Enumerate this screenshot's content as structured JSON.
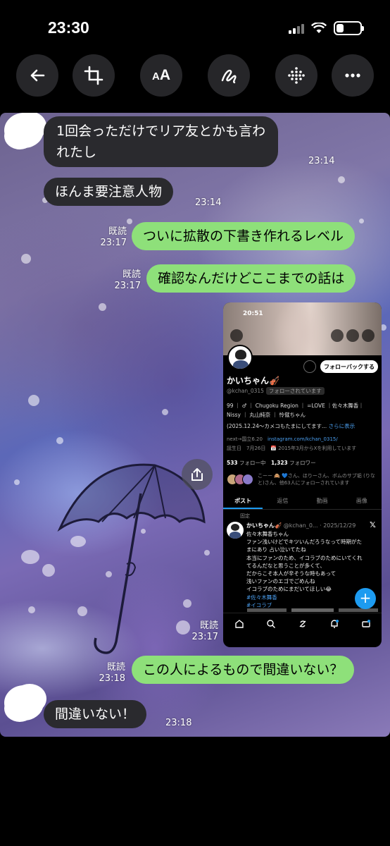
{
  "status_bar": {
    "time": "23:30"
  },
  "toolbar": {
    "text_size_small": "A",
    "text_size_large": "A"
  },
  "chat": {
    "messages": [
      {
        "side": "left",
        "line1": "1回会っただけでリア友とかも言わ",
        "line2": "れたし",
        "time": "23:14"
      },
      {
        "side": "left",
        "text": "ほんま要注意人物",
        "time": "23:14"
      },
      {
        "side": "right",
        "text": "ついに拡散の下書き作れるレベル",
        "read": "既読",
        "time": "23:17"
      },
      {
        "side": "right",
        "text": "確認なんだけどここまでの話は",
        "read": "既読",
        "time": "23:17"
      },
      {
        "side": "right",
        "type": "image",
        "read": "既読",
        "time": "23:17"
      },
      {
        "side": "right",
        "text": "この人によるもので間違いない？",
        "read": "既読",
        "time": "23:18"
      },
      {
        "side": "left",
        "text": "間違いない！",
        "time": "23:18"
      }
    ]
  },
  "twitter": {
    "time": "20:51",
    "follow_back": "フォローバックする",
    "name": "かいちゃん🎻",
    "handle": "@kchan_0315",
    "follows_you": "フォローされています",
    "bio_line1": "99 ｜ ♂ ｜ Chugoku Region ｜ =LOVE ｜佐々木舞香｜",
    "bio_line2": "Nissy ｜ 丸山純奈 ｜ 怜僦ちゃん",
    "bio_line3_prefix": "(2025.12.24〜カメコもたまにしてます...",
    "bio_more": "さらに表示",
    "meta_line1_prefix": "next→国立6.20",
    "meta_link": "instagram.com/kchan_0315/",
    "meta_line2": "誕生日　7月26日　📅 2015年3月からXを利用しています",
    "following_count": "533",
    "following_label": "フォロー中",
    "followers_count": "1,323",
    "followers_label": "フォロワー",
    "mutual_line1": "こーー 🙈 💙さん、ほりーさん、ボムのサブ垢 (りな",
    "mutual_line2": "と)さん、他63人にフォローされています",
    "tabs": [
      "ポスト",
      "返信",
      "動画",
      "画像"
    ],
    "pinned_label": "固定",
    "post_name": "かいちゃん🎻",
    "post_meta": "@kchan_0... · 2025/12/29",
    "post_lines": [
      "佐々木舞香ちゃん",
      "ファン浅いけどでキツいんだろうなって時期がた",
      "まにあり 占い泣いてたね",
      "本当にファンのため、イコラブのためにいてくれ",
      "てるんだなと思うことが多くて、",
      "だからこそ本人が辛そうな時もあって",
      "浅いファンのエゴでごめんね",
      "イコラブのためにまだいてほしい😂"
    ],
    "post_tags": [
      "#佐々木舞香",
      "#イコラブ"
    ],
    "fab": "+"
  },
  "colors": {
    "green_bubble": "#8ee07a",
    "dark_bubble": "#2a2a2e",
    "toolbar_button": "#262629",
    "twitter_blue": "#1d9bf0"
  },
  "icons": [
    "back-arrow-icon",
    "crop-icon",
    "text-size-icon",
    "markup-icon",
    "grid-icon",
    "more-icon",
    "share-icon"
  ]
}
